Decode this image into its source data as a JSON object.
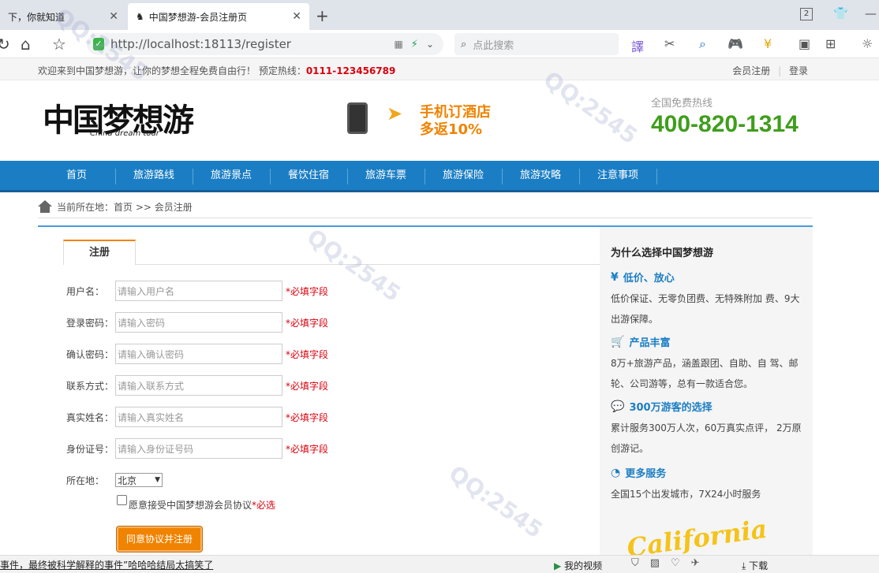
{
  "browser": {
    "tabs": [
      {
        "label": "下，你就知道"
      },
      {
        "label": "中国梦想游-会员注册页"
      }
    ],
    "tab_count": "2",
    "url_host": "http://localhost",
    "url_rest": ":18113/register",
    "search_placeholder": "点此搜索"
  },
  "topbar": {
    "welcome": "欢迎来到中国梦想游，让你的梦想全程免费自由行！ 预定热线：",
    "hotline": "0111-123456789",
    "register_link": "会员注册",
    "sep": "|",
    "login_link": "登录"
  },
  "header": {
    "logo_cn": "中国梦想游",
    "logo_en": "China dream tour",
    "promo_line1": "手机订酒店",
    "promo_line2": "多返10%",
    "hotline_label": "全国免费热线",
    "hotline_number": "400-820-1314"
  },
  "nav": {
    "items": [
      "首页",
      "旅游路线",
      "旅游景点",
      "餐饮住宿",
      "旅游车票",
      "旅游保险",
      "旅游攻略",
      "注意事项"
    ]
  },
  "breadcrumb": {
    "text": "当前所在地：首页 >> 会员注册"
  },
  "form": {
    "tab_label": "注册",
    "fields": [
      {
        "label": "用户名：",
        "placeholder": "请输入用户名",
        "required": "*必填字段"
      },
      {
        "label": "登录密码：",
        "placeholder": "请输入密码",
        "required": "*必填字段"
      },
      {
        "label": "确认密码：",
        "placeholder": "请输入确认密码",
        "required": "*必填字段"
      },
      {
        "label": "联系方式：",
        "placeholder": "请输入联系方式",
        "required": "*必填字段"
      },
      {
        "label": "真实姓名：",
        "placeholder": "请输入真实姓名",
        "required": "*必填字段"
      },
      {
        "label": "身份证号：",
        "placeholder": "请输入身份证号码",
        "required": "*必填字段"
      }
    ],
    "city_label": "所在地：",
    "city_value": "北京",
    "agree_text": "愿意接受中国梦想游会员协议",
    "agree_required": "*必选",
    "submit_label": "同意协议并注册"
  },
  "sidebar": {
    "title": "为什么选择中国梦想游",
    "sections": [
      {
        "heading": "低价、放心",
        "icon": "yen-icon",
        "text": "低价保证、无零负团费、无特殊附加 费、9大出游保障。"
      },
      {
        "heading": "产品丰富",
        "icon": "cart-icon",
        "text": "8万+旅游产品，涵盖跟团、自助、自 驾、邮轮、公司游等，总有一款适合您。"
      },
      {
        "heading": "300万游客的选择",
        "icon": "chat-icon",
        "text": "累计服务300万人次，60万真实点评， 2万原创游记。"
      },
      {
        "heading": "更多服务",
        "icon": "24h-icon",
        "text": "全国15个出发城市，7X24小时服务"
      }
    ],
    "banner_text": "California"
  },
  "statusbar": {
    "news": "事件，最终被科学解释的事件”哈哈哈结局太搞笑了",
    "videos": "我的视频",
    "download": "下载"
  },
  "colors": {
    "nav_blue": "#1b7ec4",
    "accent_orange": "#f08300",
    "hotline_green": "#3f9e1c",
    "required_red": "#d9000d"
  }
}
